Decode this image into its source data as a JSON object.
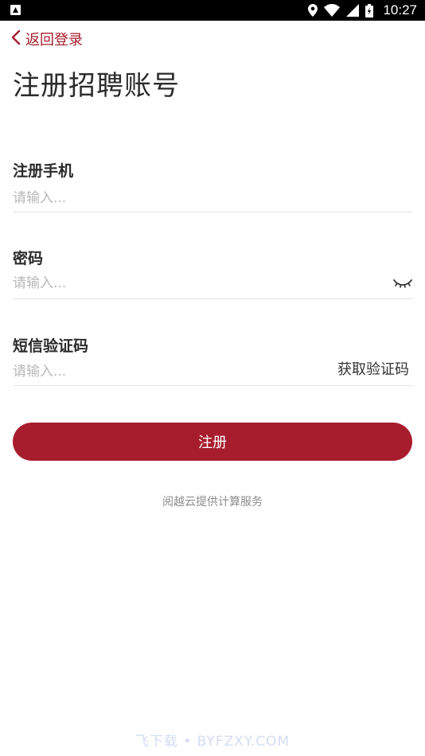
{
  "status_bar": {
    "time": "10:27",
    "icons": [
      "location-icon",
      "wifi-icon",
      "signal-icon",
      "battery-icon"
    ]
  },
  "header": {
    "back_label": "返回登录",
    "title": "注册招聘账号"
  },
  "form": {
    "phone": {
      "label": "注册手机",
      "placeholder": "请输入...",
      "value": ""
    },
    "password": {
      "label": "密码",
      "placeholder": "请输入...",
      "value": ""
    },
    "sms_code": {
      "label": "短信验证码",
      "placeholder": "请输入...",
      "value": "",
      "get_code_label": "获取验证码"
    }
  },
  "register_button_label": "注册",
  "footer_note": "阅越云提供计算服务",
  "watermark": "飞下载 • BYFZXY.COM",
  "colors": {
    "accent": "#a81d2e",
    "divider": "#e3e3e3",
    "placeholder": "#b8b8b8"
  }
}
